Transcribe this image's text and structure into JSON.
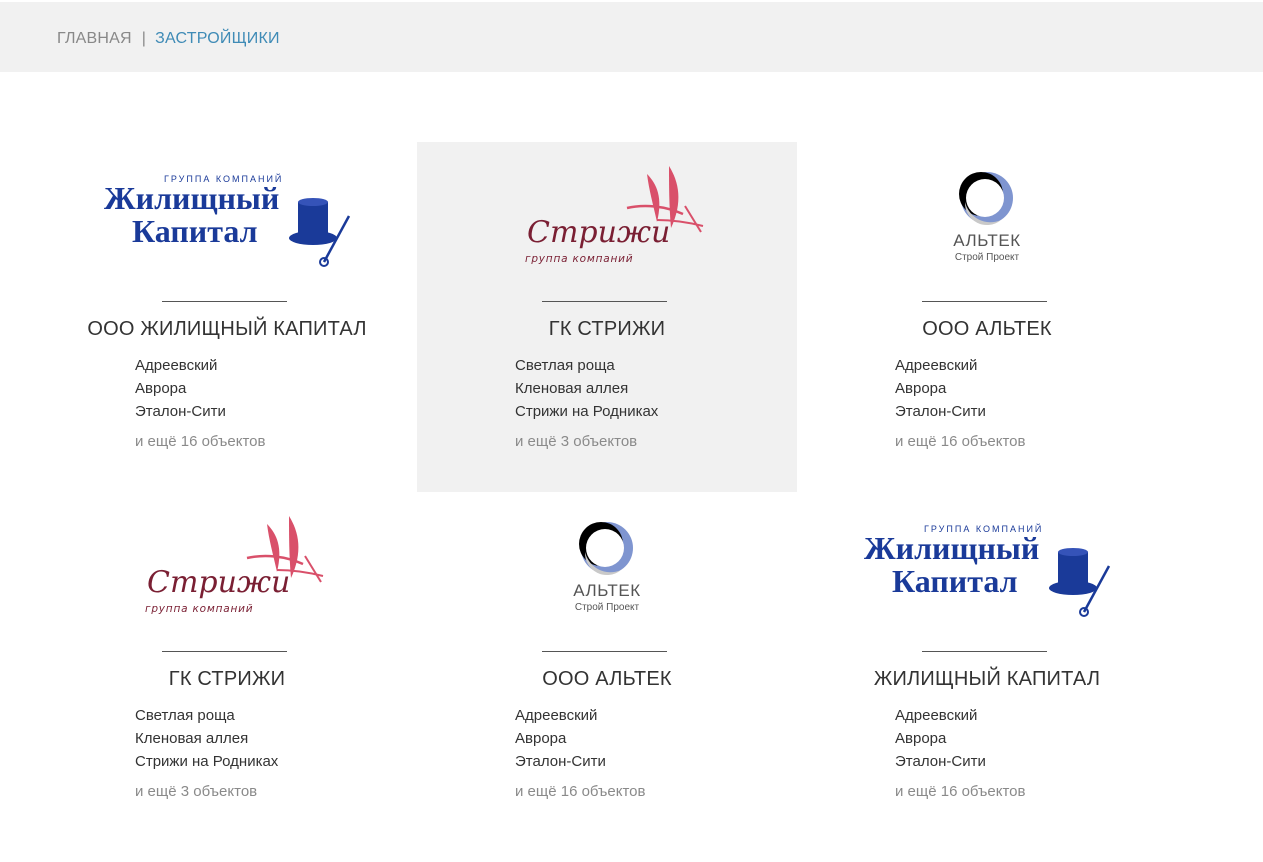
{
  "breadcrumb": {
    "home": "ГЛАВНАЯ",
    "separator": "|",
    "current": "ЗАСТРОЙЩИКИ"
  },
  "colors": {
    "header_bg": "#f1f1f1",
    "breadcrumb_active": "#3f8bb6",
    "zhk_blue": "#1a3a99",
    "strizhi_dark": "#7a1f33",
    "strizhi_pink": "#d9506a",
    "altek_blue": "#7f95d0"
  },
  "developers": [
    {
      "logo": "zhilishchny-kapital-logo",
      "logo_text": {
        "top": "ГРУППА КОМПАНИЙ",
        "line1": "Жилищный",
        "line2": "Капитал"
      },
      "name": "ООО ЖИЛИЩНЫЙ КАПИТАЛ",
      "objects": [
        "Адреевский",
        "Аврора",
        "Эталон-Сити"
      ],
      "more": "и ещё 16 объектов",
      "highlighted": false
    },
    {
      "logo": "strizhi-logo",
      "logo_text": {
        "main": "Стрижи",
        "sub": "группа компаний"
      },
      "name": "ГК СТРИЖИ",
      "objects": [
        "Светлая роща",
        "Кленовая аллея",
        "Стрижи на Родниках"
      ],
      "more": "и ещё 3 объектов",
      "highlighted": true
    },
    {
      "logo": "altek-logo",
      "logo_text": {
        "main": "АЛЬТЕК",
        "sub": "Строй Проект"
      },
      "name": "ООО АЛЬТЕК",
      "objects": [
        "Адреевский",
        "Аврора",
        "Эталон-Сити"
      ],
      "more": "и ещё 16 объектов",
      "highlighted": false
    },
    {
      "logo": "strizhi-logo",
      "logo_text": {
        "main": "Стрижи",
        "sub": "группа компаний"
      },
      "name": "ГК СТРИЖИ",
      "objects": [
        "Светлая роща",
        "Кленовая аллея",
        "Стрижи на Родниках"
      ],
      "more": "и ещё 3 объектов",
      "highlighted": false
    },
    {
      "logo": "altek-logo",
      "logo_text": {
        "main": "АЛЬТЕК",
        "sub": "Строй Проект"
      },
      "name": "ООО АЛЬТЕК",
      "objects": [
        "Адреевский",
        "Аврора",
        "Эталон-Сити"
      ],
      "more": "и ещё 16 объектов",
      "highlighted": false
    },
    {
      "logo": "zhilishchny-kapital-logo",
      "logo_text": {
        "top": "ГРУППА КОМПАНИЙ",
        "line1": "Жилищный",
        "line2": "Капитал"
      },
      "name": "ЖИЛИЩНЫЙ КАПИТАЛ",
      "objects": [
        "Адреевский",
        "Аврора",
        "Эталон-Сити"
      ],
      "more": "и ещё 16 объектов",
      "highlighted": false
    }
  ]
}
